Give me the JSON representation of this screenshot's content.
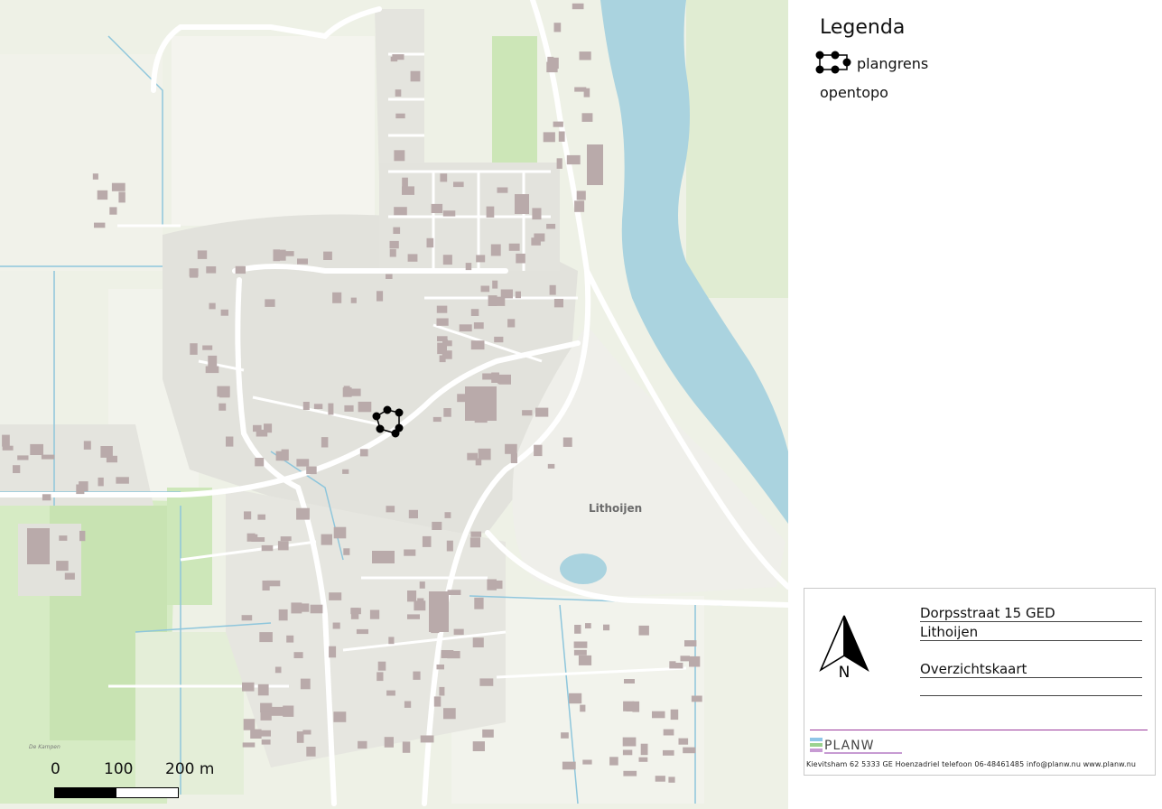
{
  "legend": {
    "title": "Legenda",
    "items": [
      {
        "label": "plangrens",
        "symbol": "polygon-with-vertex-dots"
      },
      {
        "label": "opentopo"
      }
    ]
  },
  "map": {
    "place_label": "Lithoijen",
    "secondary_label": "De Kampen",
    "colors": {
      "water": "#aad3df",
      "background": "#eef1e6",
      "green_field": "#cfe6be",
      "built_area": "#e2e2dc",
      "building": "#b8a9a9",
      "road": "#ffffff",
      "ditch": "#8ec6dc"
    }
  },
  "titleblock": {
    "line1": "Dorpsstraat 15 GED",
    "line2": "Lithoijen",
    "line3": "Overzichtskaart",
    "line4": "",
    "north_label": "N",
    "logo_text": "PLANW",
    "footer": "Kievitsham 62 5333 GE Hoenzadriel telefoon 06-48461485 info@planw.nu www.planw.nu"
  },
  "scalebar": {
    "labels": [
      "0",
      "100",
      "200 m"
    ],
    "unit": "m"
  }
}
